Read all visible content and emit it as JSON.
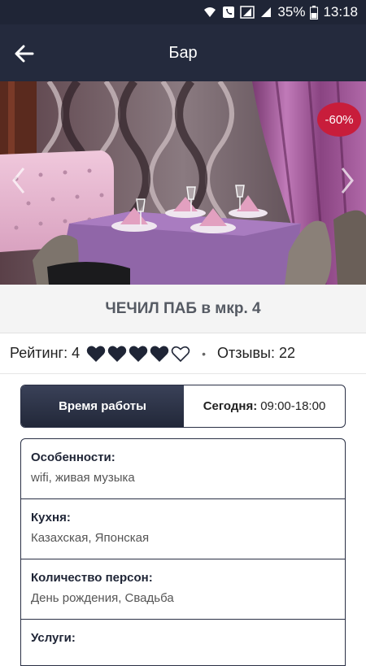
{
  "status_bar": {
    "battery": "35%",
    "time": "13:18"
  },
  "app_bar": {
    "title": "Бар"
  },
  "hero": {
    "discount": "-60%"
  },
  "venue": {
    "name": "ЧЕЧИЛ ПАБ в мкр. 4"
  },
  "rating": {
    "label": "Рейтинг: 4",
    "value": 4,
    "max": 5,
    "reviews_label": "Отзывы: 22"
  },
  "hours": {
    "button_label": "Время работы",
    "today_label": "Сегодня:",
    "today_value": "09:00-18:00"
  },
  "features": [
    {
      "label": "Особенности:",
      "value": "wifi, живая музыка"
    },
    {
      "label": "Кухня:",
      "value": "Казахская, Японская"
    },
    {
      "label": "Количество персон:",
      "value": "День рождения, Свадьба"
    },
    {
      "label": "Услуги:",
      "value": ""
    }
  ],
  "colors": {
    "primary_dark": "#242a3d",
    "accent_red": "#c81d3b"
  }
}
